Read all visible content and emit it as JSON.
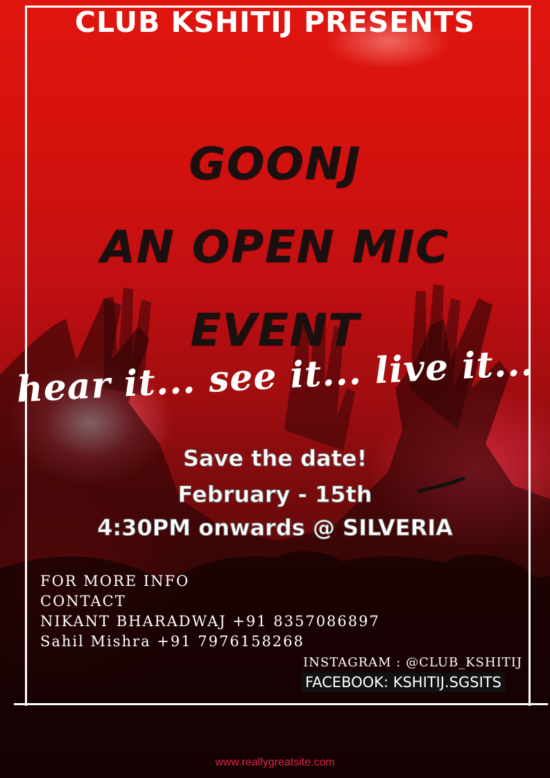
{
  "poster": {
    "presenter": "CLUB KSHITIJ PRESENTS",
    "headline_lines": [
      "GOONJ",
      "AN OPEN MIC",
      "EVENT"
    ],
    "tagline": "hear it... see it... live it...",
    "date_lines": [
      "Save the date!",
      "February - 15th",
      "4:30PM onwards @ SILVERIA"
    ],
    "info_lines": [
      "FOR MORE INFO",
      "CONTACT",
      "NIKANT BHARADWAJ +91 8357086897",
      "Sahil Mishra +91 7976158268"
    ],
    "instagram": "INSTAGRAM : @CLUB_KSHITIJ",
    "facebook": "FACEBOOK: KSHITIJ.SGSITS",
    "footer_url": "www.reallygreatsite.com"
  },
  "colors": {
    "background_top": "#e0150f",
    "background_bottom": "#1a0404",
    "headline_text": "#1a1010",
    "white_text": "#ffffff",
    "footer_text": "#e0244a"
  }
}
